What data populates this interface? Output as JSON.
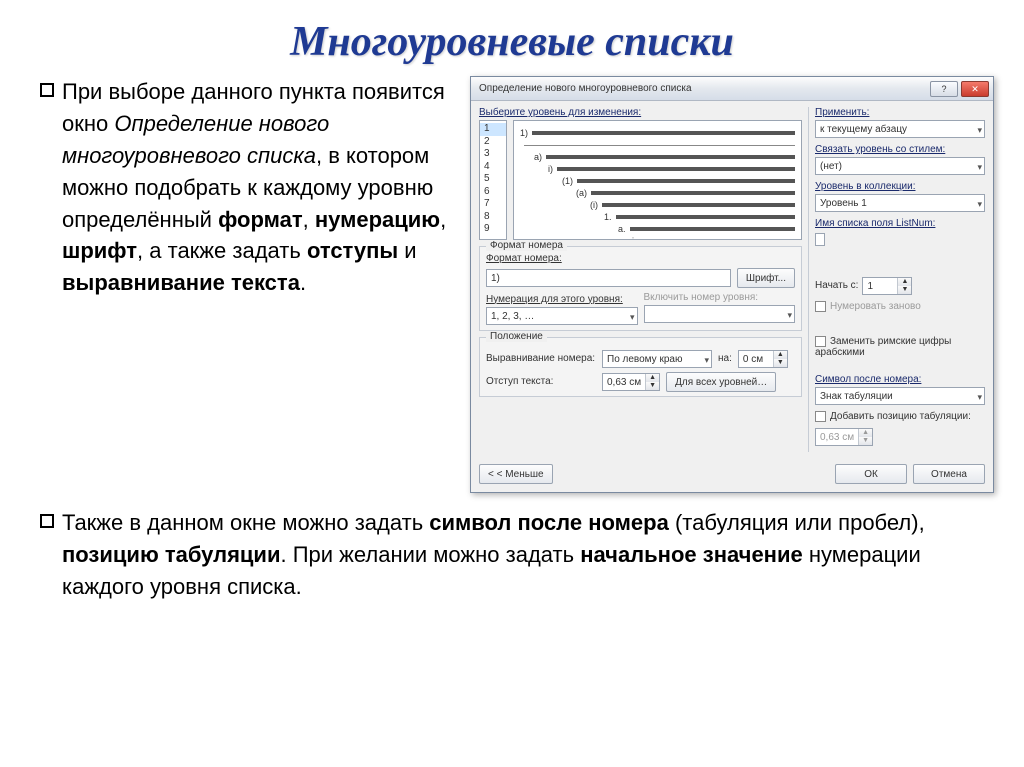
{
  "title": "Многоуровневые списки",
  "para1": {
    "pre": "При выборе данного пункта появится окно ",
    "italic": "Определение нового многоуровневого списка",
    "mid": ", в котором можно подобрать к каждому уровню определённый ",
    "b1": "формат",
    "c1": ", ",
    "b2": "нумерацию",
    "c2": ", ",
    "b3": "шрифт",
    "c3": ", а также задать ",
    "b4": "отступы",
    "c4": " и ",
    "b5": "выравнивание текста",
    "end": "."
  },
  "para2": {
    "pre": "Также в данном окне можно задать ",
    "b1": "символ после номера",
    "mid1": " (табуляция или пробел), ",
    "b2": "позицию табуляции",
    "mid2": ". При желании можно  задать ",
    "b3": "начальное значение",
    "mid3": " нумерации каждого уровня списка."
  },
  "dialog": {
    "title": "Определение нового многоуровневого списка",
    "help": "?",
    "close": "✕",
    "pick_level": "Выберите уровень для изменения:",
    "levels": [
      "1",
      "2",
      "3",
      "4",
      "5",
      "6",
      "7",
      "8",
      "9"
    ],
    "preview_labels": [
      "1)",
      "a)",
      "i)",
      "(1)",
      "(a)",
      "(i)",
      "1.",
      "a.",
      "i."
    ],
    "grp_format": "Формат номера",
    "lbl_format": "Формат номера:",
    "fmt_value": "1)",
    "btn_font": "Шрифт...",
    "lbl_numbering": "Нумерация для этого уровня:",
    "numbering": "1, 2, 3, …",
    "lbl_include": "Включить номер уровня:",
    "grp_position": "Положение",
    "lbl_align": "Выравнивание номера:",
    "align": "По левому краю",
    "lbl_at": "на:",
    "at": "0 см",
    "lbl_indent": "Отступ текста:",
    "indent": "0,63 см",
    "btn_all_levels": "Для всех уровней…",
    "btn_less": "< < Меньше",
    "btn_ok": "ОК",
    "btn_cancel": "Отмена",
    "right": {
      "lbl_apply": "Применить:",
      "apply": "к текущему абзацу",
      "lbl_link_style": "Связать уровень со стилем:",
      "link_style": "(нет)",
      "lbl_collection": "Уровень в коллекции:",
      "collection": "Уровень 1",
      "lbl_listnum": "Имя списка поля ListNum:",
      "lbl_start": "Начать с:",
      "start": "1",
      "chk_restart": "Нумеровать заново",
      "chk_roman": "Заменить римские цифры арабскими",
      "lbl_sym": "Символ после номера:",
      "sym": "Знак табуляции",
      "chk_tabpos": "Добавить позицию табуляции:",
      "tabpos": "0,63 см"
    }
  }
}
